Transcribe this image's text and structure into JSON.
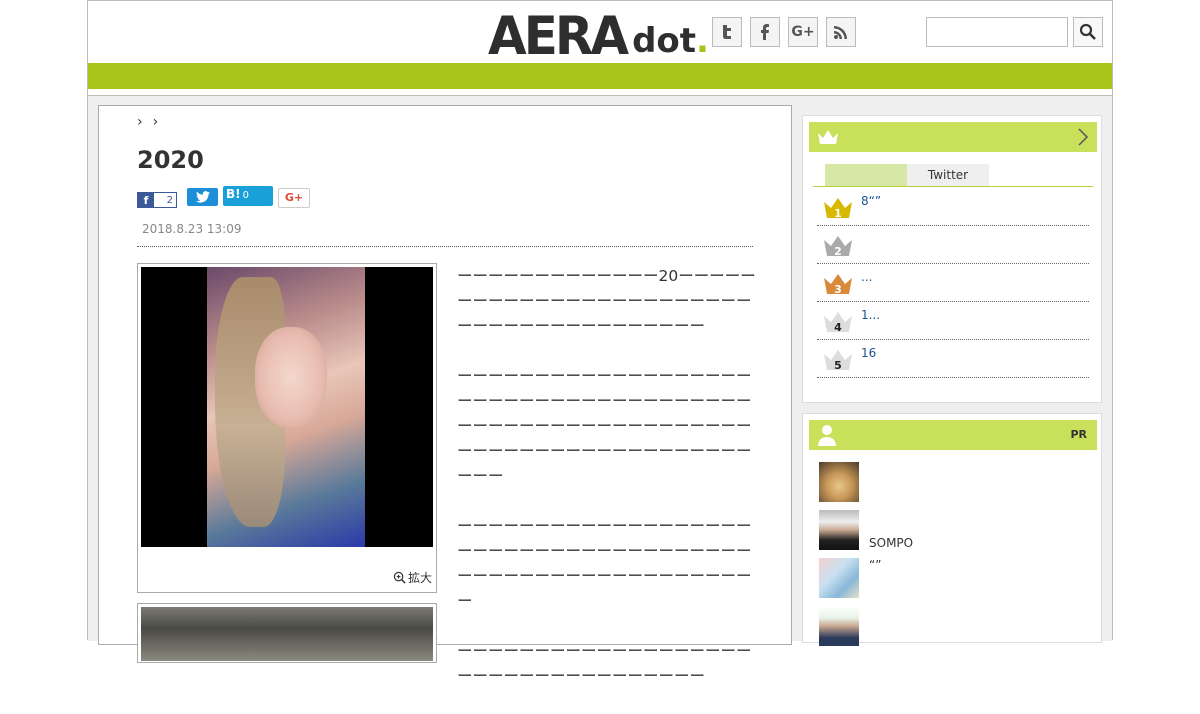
{
  "header": {
    "logo_main": "AERA",
    "logo_sub": "dot",
    "logo_period": ".",
    "social": [
      "twitter-icon",
      "facebook-icon",
      "google-plus-icon",
      "rss-icon"
    ],
    "social_glyphs": [
      "t",
      "f",
      "G+",
      "◉"
    ],
    "search_placeholder": ""
  },
  "colors": {
    "brand_green": "#a8c41a",
    "sidebar_head": "#c9e05a",
    "link_blue": "#1b5594"
  },
  "article": {
    "breadcrumb": [
      "›",
      "›"
    ],
    "title": "2020",
    "share": {
      "facebook_glyph": "f",
      "facebook_count": "2",
      "twitter_glyph": "🐦",
      "hatena_label": "B!",
      "hatena_count": "0",
      "gplus_label": "G+"
    },
    "date": "2018.8.23 13:09",
    "expand_label": "拡大",
    "paragraphs": [
      "ーーーーーーーーーーーーー20ーーーーーーーーーーーーーーーーーーーーーーーーーーーーーーーーーーーーーーーー",
      "ーーーーーーーーーーーーーーーーーーーーーーーーーーーーーーーーーーーーーーーーーーーーーーーーーーーーーーーーーーーーーーーーーーーーーーーーーーーーーーー",
      "ーーーーーーーーーーーーーーーーーーーーーーーーーーーーーーーーーーーーーーーーーーーーーーーーーーーーーーーーーー",
      "ーーーーーーーーーーーーーーーーーーーーーーーーーーーーーーーーーーー"
    ]
  },
  "ranking": {
    "tabs": [
      "",
      "Twitter"
    ],
    "items": [
      {
        "rank": "1",
        "text": "8“”",
        "color": "#d8b800"
      },
      {
        "rank": "2",
        "text": "",
        "color": "#aaaaaa"
      },
      {
        "rank": "3",
        "text": "...",
        "color": "#d88a3a"
      },
      {
        "rank": "4",
        "text": "1...",
        "color": "#dddddd"
      },
      {
        "rank": "5",
        "text": "16",
        "color": "#dddddd"
      }
    ]
  },
  "pr": {
    "label": "PR",
    "items": [
      {
        "text": ""
      },
      {
        "text": "SOMPO"
      },
      {
        "text": "“”"
      },
      {
        "text": ""
      }
    ]
  }
}
